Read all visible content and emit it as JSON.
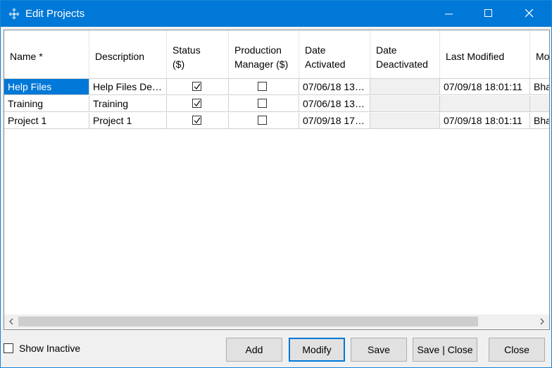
{
  "window": {
    "title": "Edit Projects"
  },
  "table": {
    "columns": [
      "Name *",
      "Description",
      "Status\n($)",
      "Production\nManager ($)",
      "Date\nActivated",
      "Date\nDeactivated",
      "Last Modified",
      "Mo"
    ],
    "rows": [
      {
        "name": "Help Files",
        "description": "Help Files De…",
        "status": true,
        "production_manager": false,
        "date_activated": "07/06/18 13…",
        "date_deactivated": "",
        "last_modified": "07/09/18 18:01:11",
        "modified_by": "Bha"
      },
      {
        "name": "Training",
        "description": "Training",
        "status": true,
        "production_manager": false,
        "date_activated": "07/06/18 13…",
        "date_deactivated": "",
        "last_modified": "",
        "modified_by": ""
      },
      {
        "name": "Project 1",
        "description": "Project 1",
        "status": true,
        "production_manager": false,
        "date_activated": "07/09/18 17…",
        "date_deactivated": "",
        "last_modified": "07/09/18 18:01:11",
        "modified_by": "Bha"
      }
    ],
    "selected_row": 0
  },
  "show_inactive": {
    "label": "Show Inactive",
    "checked": false
  },
  "buttons": {
    "add": "Add",
    "modify": "Modify",
    "save": "Save",
    "save_close": "Save | Close",
    "close": "Close"
  },
  "icons": {
    "app": "app-diamond-icon",
    "minimize": "minimize-icon",
    "maximize": "maximize-icon",
    "close": "close-icon",
    "scroll_left": "chevron-left-icon",
    "scroll_right": "chevron-right-icon"
  },
  "colors": {
    "titlebar": "#0078d7",
    "selection": "#0078d7"
  }
}
